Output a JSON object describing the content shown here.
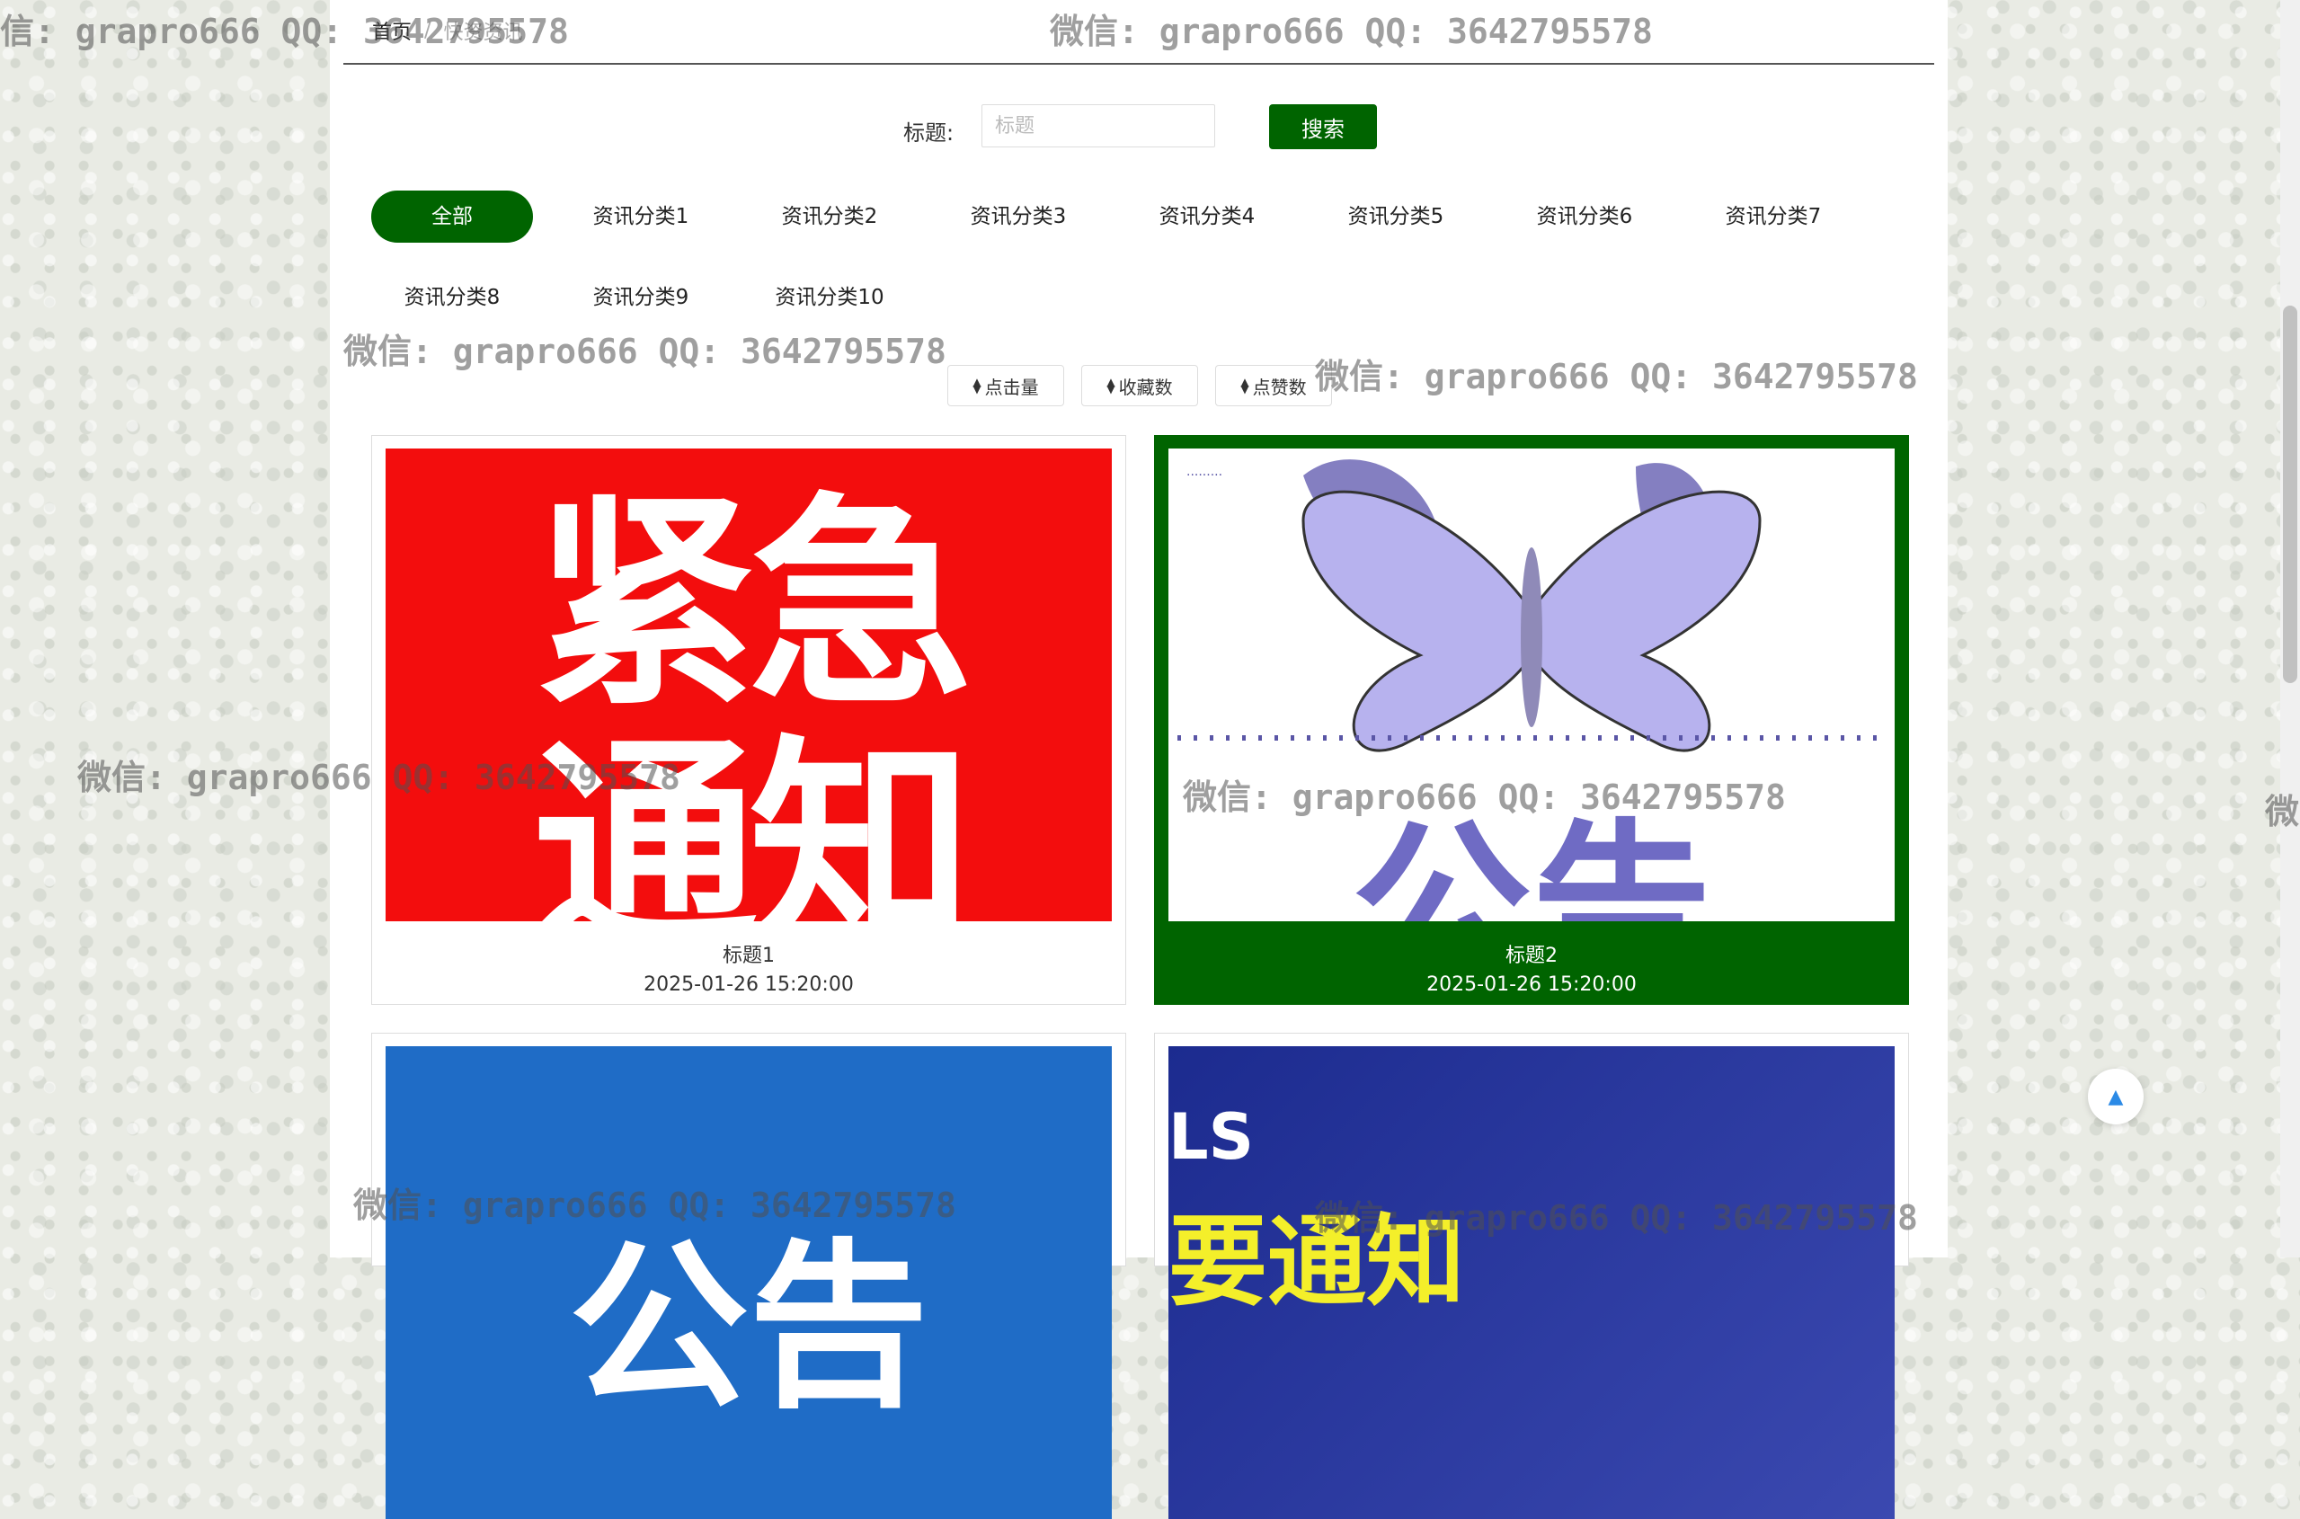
{
  "breadcrumb": {
    "home": "首页",
    "separator": "/",
    "current": "快资资讯"
  },
  "search": {
    "label": "标题:",
    "placeholder": "标题",
    "value": "",
    "button": "搜索"
  },
  "categories": [
    "全部",
    "资讯分类1",
    "资讯分类2",
    "资讯分类3",
    "资讯分类4",
    "资讯分类5",
    "资讯分类6",
    "资讯分类7",
    "资讯分类8",
    "资讯分类9",
    "资讯分类10"
  ],
  "active_category": "全部",
  "sort_buttons": [
    "点击量",
    "收藏数",
    "点赞数"
  ],
  "cards": [
    {
      "title": "标题1",
      "date": "2025-01-26 15:20:00",
      "image_text": [
        "紧急",
        "通知"
      ]
    },
    {
      "title": "标题2",
      "date": "2025-01-26 15:20:00",
      "image_text": [
        "公告"
      ]
    },
    {
      "title": "",
      "date": "",
      "image_text": [
        "公告"
      ]
    },
    {
      "title": "",
      "date": "",
      "image_text": [
        "LS",
        "要通知"
      ]
    }
  ],
  "watermark": "微信: grapro666 QQ: 3642795578",
  "watermark_partial": {
    "left": "信: grapro666 QQ: 3642795578",
    "right": "微"
  },
  "colors": {
    "accent": "#006400",
    "red_image": "#f30d0d",
    "blue_image": "#1f6cc6",
    "navy_image": "#1c2b8f"
  },
  "icons": {
    "sort": "sort-icon",
    "back_to_top": "arrow-up-icon"
  }
}
